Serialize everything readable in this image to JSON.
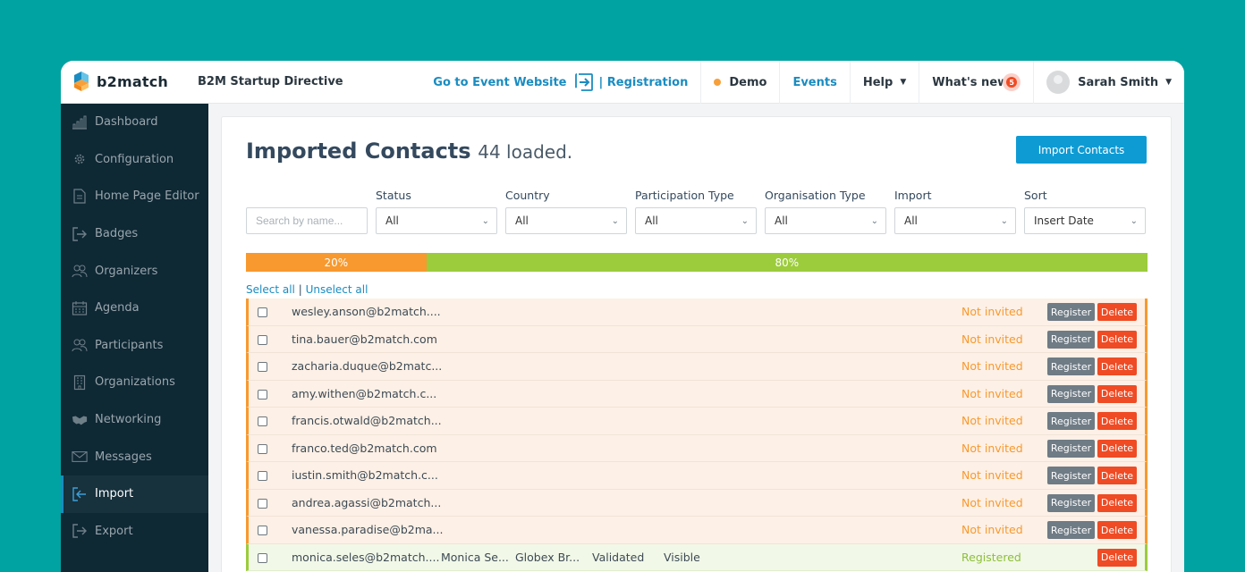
{
  "brand": {
    "name": "b2match"
  },
  "event_name": "B2M Startup Directive",
  "topnav": {
    "goto_label": "Go to Event Website",
    "registration_label": "| Registration",
    "demo_label": "Demo",
    "events_label": "Events",
    "help_label": "Help",
    "whats_new_label": "What's new",
    "notification_count": "5",
    "user_name": "Sarah Smith"
  },
  "sidebar": {
    "items": [
      {
        "label": "Dashboard",
        "icon": "chart-icon"
      },
      {
        "label": "Configuration",
        "icon": "gear-icon"
      },
      {
        "label": "Home Page Editor",
        "icon": "document-icon"
      },
      {
        "label": "Badges",
        "icon": "export-icon"
      },
      {
        "label": "Organizers",
        "icon": "people-icon"
      },
      {
        "label": "Agenda",
        "icon": "calendar-icon"
      },
      {
        "label": "Participants",
        "icon": "people-icon"
      },
      {
        "label": "Organizations",
        "icon": "building-icon"
      },
      {
        "label": "Networking",
        "icon": "handshake-icon"
      },
      {
        "label": "Messages",
        "icon": "envelope-icon"
      },
      {
        "label": "Import",
        "icon": "import-icon",
        "active": true
      },
      {
        "label": "Export",
        "icon": "export-icon"
      }
    ]
  },
  "main": {
    "title": "Imported Contacts",
    "subtitle": "44 loaded.",
    "import_button": "Import Contacts",
    "search_placeholder": "Search by name...",
    "filters": [
      {
        "label": "Status",
        "value": "All"
      },
      {
        "label": "Country",
        "value": "All"
      },
      {
        "label": "Participation Type",
        "value": "All"
      },
      {
        "label": "Organisation Type",
        "value": "All"
      },
      {
        "label": "Import",
        "value": "All"
      },
      {
        "label": "Sort",
        "value": "Insert Date"
      }
    ],
    "progress": {
      "pending_label": "20%",
      "pending_fraction": 0.2,
      "registered_label": "80%",
      "registered_fraction": 0.8
    },
    "select_all": "Select all",
    "separator": "|",
    "unselect_all": "Unselect all",
    "register_label": "Register",
    "delete_label": "Delete",
    "rows": [
      {
        "email": "wesley.anson@b2match....",
        "status": "Not invited"
      },
      {
        "email": "tina.bauer@b2match.com",
        "status": "Not invited"
      },
      {
        "email": "zacharia.duque@b2matc...",
        "status": "Not invited"
      },
      {
        "email": "amy.withen@b2match.c...",
        "status": "Not invited"
      },
      {
        "email": "francis.otwald@b2match...",
        "status": "Not invited"
      },
      {
        "email": "franco.ted@b2match.com",
        "status": "Not invited"
      },
      {
        "email": "iustin.smith@b2match.c...",
        "status": "Not invited"
      },
      {
        "email": "andrea.agassi@b2match...",
        "status": "Not invited"
      },
      {
        "email": "vanessa.paradise@b2ma...",
        "status": "Not invited"
      },
      {
        "email": "monica.seles@b2match....",
        "name": "Monica Se...",
        "org": "Globex Br...",
        "validation": "Validated",
        "visibility": "Visible",
        "status": "Registered"
      }
    ]
  },
  "colors": {
    "background": "#00a3a1",
    "sidebar": "#0e2834",
    "accent": "#1a8cc1",
    "pending": "#f7992e",
    "registered": "#9ccc3c",
    "delete": "#ef4b24"
  }
}
